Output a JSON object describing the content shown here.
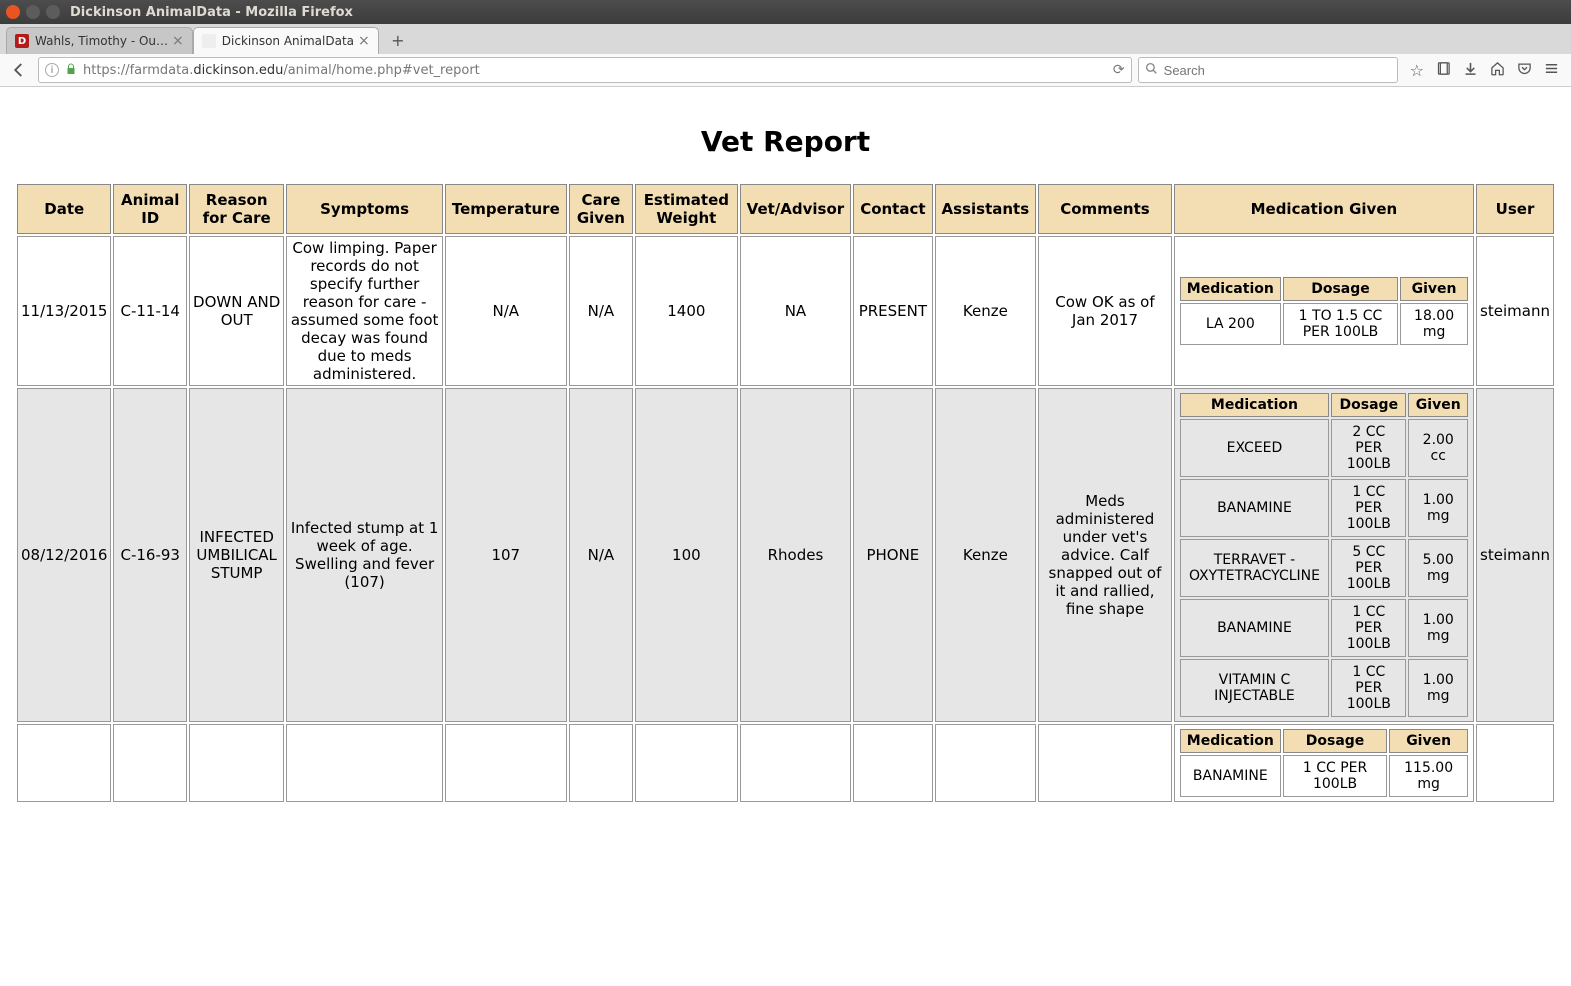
{
  "os": {
    "title": "Dickinson AnimalData - Mozilla Firefox"
  },
  "browser": {
    "tabs": [
      {
        "title": "Wahls, Timothy - Ou…",
        "active": false
      },
      {
        "title": "Dickinson AnimalData",
        "active": true
      }
    ],
    "url_prefix": "https://farmdata.",
    "url_highlight": "dickinson.edu",
    "url_suffix": "/animal/home.php#vet_report",
    "search_placeholder": "Search"
  },
  "page": {
    "title": "Vet Report"
  },
  "columns": [
    "Date",
    "Animal ID",
    "Reason for Care",
    "Symptoms",
    "Temperature",
    "Care Given",
    "Estimated Weight",
    "Vet/Advisor",
    "Contact",
    "Assistants",
    "Comments",
    "Medication Given",
    "User"
  ],
  "med_columns": [
    "Medication",
    "Dosage",
    "Given"
  ],
  "rows": [
    {
      "date": "11/13/2015",
      "animal_id": "C-11-14",
      "reason": "DOWN AND OUT",
      "symptoms": "Cow limping. Paper records do not specify further reason for care - assumed some foot decay was found due to meds administered.",
      "temperature": "N/A",
      "care_given": "N/A",
      "est_weight": "1400",
      "vet": "NA",
      "contact": "PRESENT",
      "assistants": "Kenze",
      "comments": "Cow OK as of Jan 2017",
      "user": "steimann",
      "meds": [
        {
          "medication": "LA 200",
          "dosage": "1 TO 1.5 CC PER 100LB",
          "given": "18.00 mg"
        }
      ]
    },
    {
      "date": "08/12/2016",
      "animal_id": "C-16-93",
      "reason": "INFECTED UMBILICAL STUMP",
      "symptoms": "Infected stump at 1 week of age. Swelling and fever (107)",
      "temperature": "107",
      "care_given": "N/A",
      "est_weight": "100",
      "vet": "Rhodes",
      "contact": "PHONE",
      "assistants": "Kenze",
      "comments": "Meds administered under vet's advice. Calf snapped out of it and rallied, fine shape",
      "user": "steimann",
      "meds": [
        {
          "medication": "EXCEED",
          "dosage": "2 CC PER 100LB",
          "given": "2.00 cc"
        },
        {
          "medication": "BANAMINE",
          "dosage": "1 CC PER 100LB",
          "given": "1.00 mg"
        },
        {
          "medication": "TERRAVET - OXYTETRACYCLINE",
          "dosage": "5 CC PER 100LB",
          "given": "5.00 mg"
        },
        {
          "medication": "BANAMINE",
          "dosage": "1 CC PER 100LB",
          "given": "1.00 mg"
        },
        {
          "medication": "VITAMIN C INJECTABLE",
          "dosage": "1 CC PER 100LB",
          "given": "1.00 mg"
        }
      ]
    },
    {
      "date": "",
      "animal_id": "",
      "reason": "",
      "symptoms": "",
      "temperature": "",
      "care_given": "",
      "est_weight": "",
      "vet": "",
      "contact": "",
      "assistants": "",
      "comments": "",
      "user": "",
      "meds": [
        {
          "medication": "BANAMINE",
          "dosage": "1 CC PER 100LB",
          "given": "115.00 mg"
        }
      ]
    }
  ]
}
